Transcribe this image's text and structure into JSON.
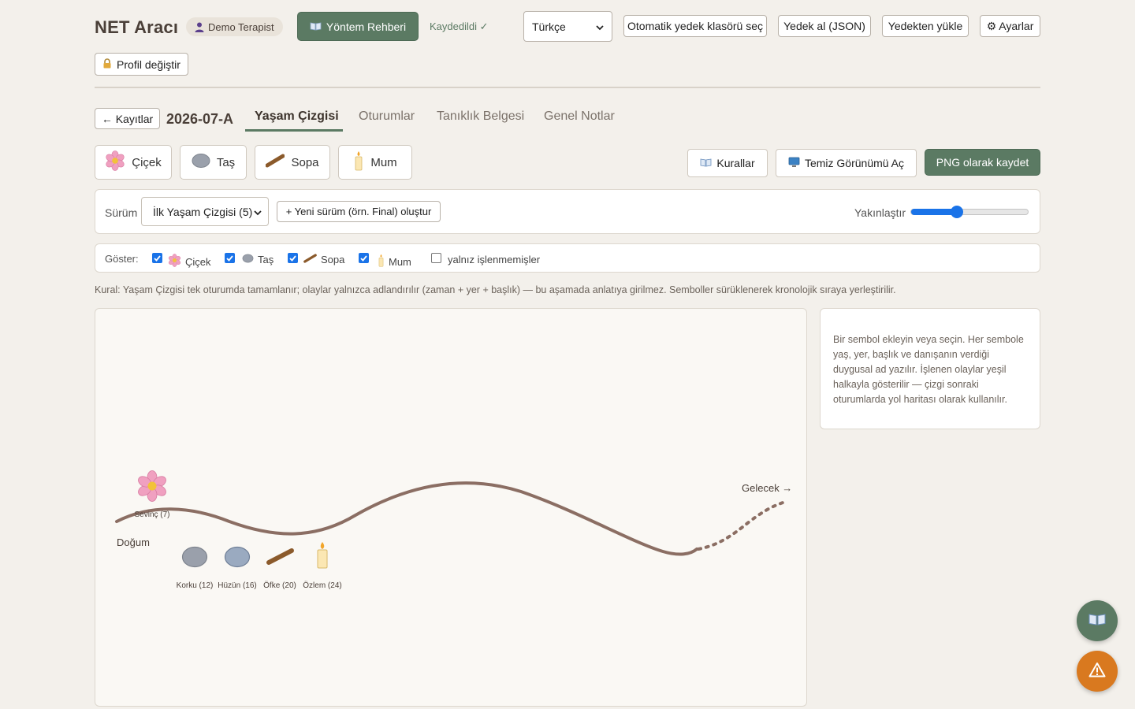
{
  "header": {
    "app_title": "NET Aracı",
    "user_name": "Demo Terapist",
    "guide_button": "Yöntem Rehberi",
    "save_status": "Kaydedildi ✓",
    "language": "Türkçe",
    "auto_backup_button": "Otomatik yedek klasörü seç",
    "backup_button": "Yedek al (JSON)",
    "restore_button": "Yedekten yükle",
    "settings_button": "⚙ Ayarlar",
    "profile_button": "Profil değiştir"
  },
  "nav": {
    "back_button": "← Kayıtlar",
    "case_id": "2026-07-A",
    "tabs": [
      {
        "label": "Yaşam Çizgisi",
        "active": true
      },
      {
        "label": "Oturumlar",
        "active": false
      },
      {
        "label": "Tanıklık Belgesi",
        "active": false
      },
      {
        "label": "Genel Notlar",
        "active": false
      }
    ]
  },
  "toolbar": {
    "symbols": [
      {
        "label": "Çiçek",
        "icon": "flower-icon"
      },
      {
        "label": "Taş",
        "icon": "stone-icon"
      },
      {
        "label": "Sopa",
        "icon": "stick-icon"
      },
      {
        "label": "Mum",
        "icon": "candle-icon"
      }
    ],
    "rules_button": "Kurallar",
    "clean_view_button": "Temiz Görünümü Aç",
    "png_button": "PNG olarak kaydet"
  },
  "version": {
    "label": "Sürüm",
    "selected": "İlk Yaşam Çizgisi (5)",
    "new_version_button": "+ Yeni sürüm (örn. Final) oluştur",
    "zoom_label": "Yakınlaştır",
    "zoom_fraction": 0.37
  },
  "filter": {
    "label": "Göster:",
    "items": [
      {
        "label": "Çiçek",
        "checked": true,
        "icon": "flower-icon"
      },
      {
        "label": "Taş",
        "checked": true,
        "icon": "stone-icon"
      },
      {
        "label": "Sopa",
        "checked": true,
        "icon": "stick-icon"
      },
      {
        "label": "Mum",
        "checked": true,
        "icon": "candle-icon"
      }
    ],
    "unprocessed_label": "yalnız işlenmemişler",
    "unprocessed_checked": false
  },
  "rule_text": "Kural: Yaşam Çizgisi tek oturumda tamamlanır; olaylar yalnızca adlandırılır (zaman + yer + başlık) — bu aşamada anlatıya girilmez. Semboller sürüklenerek kronolojik sıraya yerleştirilir.",
  "timeline": {
    "start_label": "Doğum",
    "end_label": "Gelecek →",
    "events": [
      {
        "type": "flower",
        "label": "Sevinç (7)"
      },
      {
        "type": "stone",
        "label": "Korku (12)"
      },
      {
        "type": "stone",
        "label": "Hüzün (16)"
      },
      {
        "type": "stick",
        "label": "Öfke (20)"
      },
      {
        "type": "candle",
        "label": "Özlem (24)"
      }
    ]
  },
  "side_panel": {
    "help_text": "Bir sembol ekleyin veya seçin. Her sembole yaş, yer, başlık ve danışanın verdiği duygusal ad yazılır. İşlenen olaylar yeşil halkayla gösterilir — çizgi sonraki oturumlarda yol haritası olarak kullanılır."
  },
  "colors": {
    "accent": "#5b7a63",
    "background": "#f3f0eb",
    "line": "#8b6e63",
    "alert": "#d9791f"
  }
}
